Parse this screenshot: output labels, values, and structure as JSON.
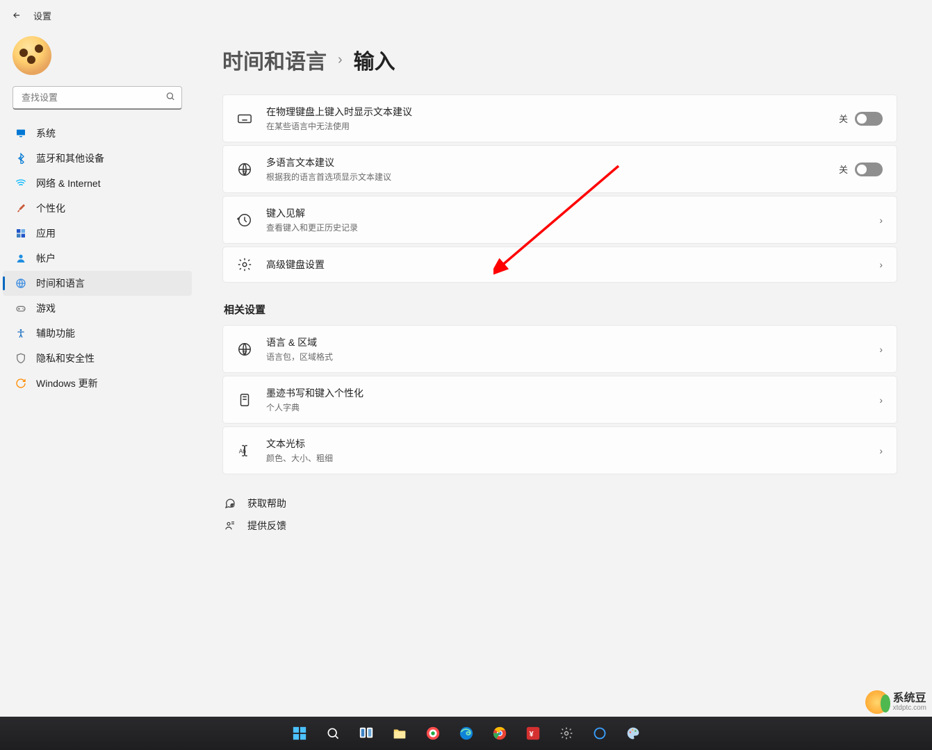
{
  "title": "设置",
  "search": {
    "placeholder": "查找设置"
  },
  "sidebar": {
    "items": [
      {
        "label": "系统",
        "icon": "monitor",
        "color": "#0078d4"
      },
      {
        "label": "蓝牙和其他设备",
        "icon": "bluetooth",
        "color": "#0078d4"
      },
      {
        "label": "网络 & Internet",
        "icon": "wifi",
        "color": "#00b7ff"
      },
      {
        "label": "个性化",
        "icon": "brush",
        "color": "#c85a3a"
      },
      {
        "label": "应用",
        "icon": "apps",
        "color": "#2256c9"
      },
      {
        "label": "帐户",
        "icon": "user",
        "color": "#1f8ee0"
      },
      {
        "label": "时间和语言",
        "icon": "globe",
        "color": "#3d8de0"
      },
      {
        "label": "游戏",
        "icon": "gamepad",
        "color": "#7a7a7a"
      },
      {
        "label": "辅助功能",
        "icon": "accessibility",
        "color": "#1b6fc2"
      },
      {
        "label": "隐私和安全性",
        "icon": "shield",
        "color": "#7a7a7a"
      },
      {
        "label": "Windows 更新",
        "icon": "update",
        "color": "#ff8c00"
      }
    ],
    "activeIndex": 6
  },
  "breadcrumb": {
    "parent": "时间和语言",
    "current": "输入"
  },
  "settings_primary": [
    {
      "icon": "keyboard",
      "title": "在物理键盘上键入时显示文本建议",
      "sub": "在某些语言中无法使用",
      "type": "toggle",
      "state_label": "关",
      "on": false
    },
    {
      "icon": "lang-globe",
      "title": "多语言文本建议",
      "sub": "根据我的语言首选项显示文本建议",
      "type": "toggle",
      "state_label": "关",
      "on": false
    },
    {
      "icon": "history",
      "title": "键入见解",
      "sub": "查看键入和更正历史记录",
      "type": "link"
    },
    {
      "icon": "gear",
      "title": "高级键盘设置",
      "sub": "",
      "type": "link"
    }
  ],
  "related_header": "相关设置",
  "settings_related": [
    {
      "icon": "lang-globe",
      "title": "语言 & 区域",
      "sub": "语言包，区域格式"
    },
    {
      "icon": "device",
      "title": "墨迹书写和键入个性化",
      "sub": "个人字典"
    },
    {
      "icon": "cursor",
      "title": "文本光标",
      "sub": "颜色、大小、粗细"
    }
  ],
  "help_links": [
    {
      "icon": "helpchat",
      "label": "获取帮助"
    },
    {
      "icon": "feedback",
      "label": "提供反馈"
    }
  ],
  "watermark": {
    "top": "系统豆",
    "bottom": "xtdptc.com"
  }
}
